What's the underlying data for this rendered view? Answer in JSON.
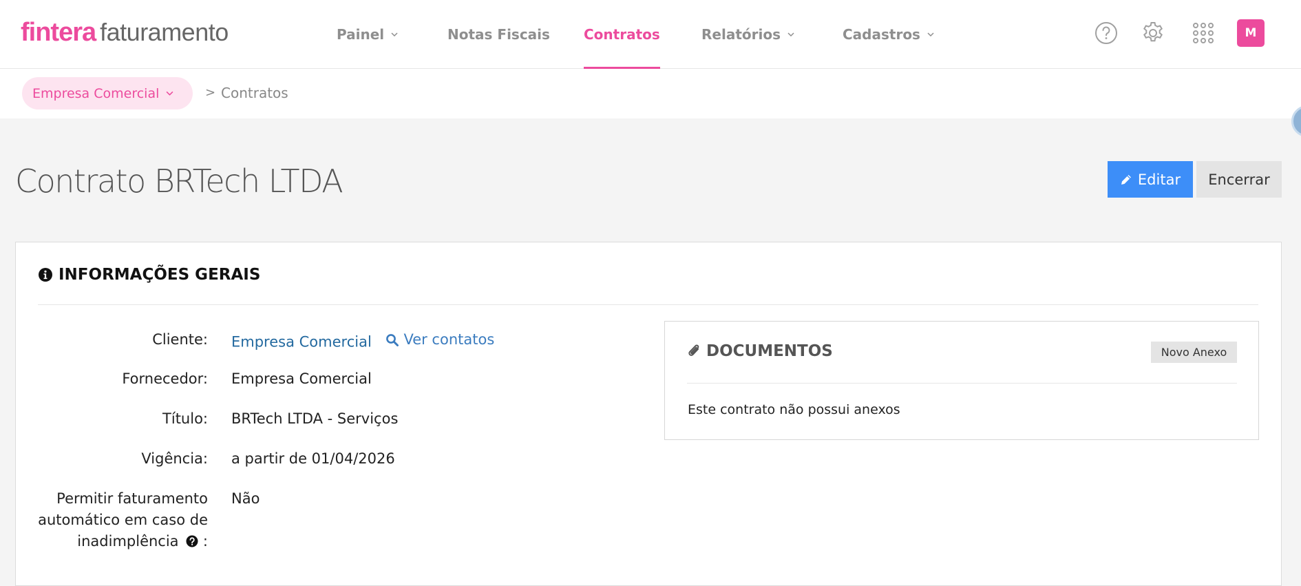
{
  "brand": {
    "name": "fintera",
    "product": "faturamento",
    "accent": "#ec4b9d"
  },
  "nav": {
    "items": [
      {
        "label": "Painel",
        "dropdown": true,
        "active": false
      },
      {
        "label": "Notas Fiscais",
        "dropdown": false,
        "active": false
      },
      {
        "label": "Contratos",
        "dropdown": false,
        "active": true
      },
      {
        "label": "Relatórios",
        "dropdown": true,
        "active": false
      },
      {
        "label": "Cadastros",
        "dropdown": true,
        "active": false
      }
    ],
    "icons": [
      "help-circle-icon",
      "gear-icon",
      "apps-grid-icon"
    ],
    "avatar_initial": "M"
  },
  "breadcrumb": {
    "company": "Empresa Comercial",
    "separator": ">",
    "current": "Contratos"
  },
  "page": {
    "title": "Contrato BRTech LTDA",
    "edit_label": "Editar",
    "end_label": "Encerrar"
  },
  "general": {
    "heading": "INFORMAÇÕES GERAIS",
    "fields": [
      {
        "label": "Cliente:",
        "value": "Empresa Comercial",
        "link_extra": "Ver contatos"
      },
      {
        "label": "Fornecedor:",
        "value": "Empresa Comercial"
      },
      {
        "label": "Título:",
        "value": "BRTech LTDA - Serviços"
      },
      {
        "label": "Vigência:",
        "value": "a partir de 01/04/2026"
      },
      {
        "label_lines": [
          "Permitir faturamento",
          "automático em caso de",
          "inadimplência"
        ],
        "label_suffix": ":",
        "value": "Não"
      }
    ]
  },
  "documents": {
    "heading": "DOCUMENTOS",
    "add_label": "Novo Anexo",
    "empty_text": "Este contrato não possui anexos"
  },
  "colors": {
    "primary_button": "#3d8ef8",
    "link": "#23699f"
  }
}
